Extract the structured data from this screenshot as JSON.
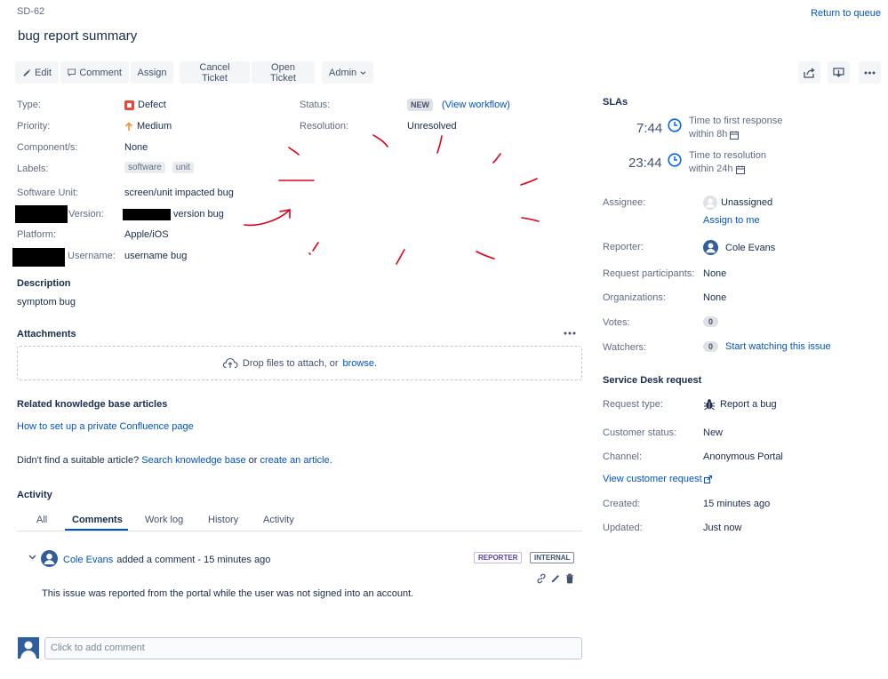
{
  "issue": {
    "key": "SD-62",
    "title": "bug report summary",
    "return_link": "Return to queue"
  },
  "toolbar": {
    "edit": "Edit",
    "comment": "Comment",
    "assign": "Assign",
    "cancel_ticket": "Cancel Ticket",
    "open_ticket": "Open Ticket",
    "admin": "Admin"
  },
  "details": {
    "type_label": "Type:",
    "type_value": "Defect",
    "priority_label": "Priority:",
    "priority_value": "Medium",
    "components_label": "Component/s:",
    "components_value": "None",
    "labels_label": "Labels:",
    "labels": [
      "software",
      "unit"
    ],
    "software_unit_label": "Software Unit:",
    "software_unit_value": "screen/unit impacted bug",
    "version_label": "Version:",
    "version_value": "version bug",
    "platform_label": "Platform:",
    "platform_value": "Apple/iOS",
    "username_label": "Username:",
    "username_value": "username bug",
    "status_label": "Status:",
    "status_value": "NEW",
    "view_workflow": "(View workflow)",
    "resolution_label": "Resolution:",
    "resolution_value": "Unresolved"
  },
  "description": {
    "title": "Description",
    "text": "symptom bug"
  },
  "attachments": {
    "title": "Attachments",
    "drop_text": "Drop files to attach, or",
    "browse": "browse."
  },
  "kb": {
    "title": "Related knowledge base articles",
    "article": "How to set up a private Confluence page",
    "prompt": "Didn't find a suitable article?",
    "search_link": "Search knowledge base",
    "or": "or",
    "create_link": "create an article."
  },
  "activity": {
    "title": "Activity",
    "tabs": [
      "All",
      "Comments",
      "Work log",
      "History",
      "Activity"
    ],
    "active_tab": "Comments",
    "comment": {
      "author": "Cole Evans",
      "meta": "added a comment - 15 minutes ago",
      "badge_reporter": "REPORTER",
      "badge_internal": "INTERNAL",
      "body": "This issue was reported from the portal while the user was not signed into an account."
    },
    "add_comment_placeholder": "Click to add comment"
  },
  "slas": {
    "title": "SLAs",
    "items": [
      {
        "time": "7:44",
        "name": "Time to first response",
        "target": "within 8h"
      },
      {
        "time": "23:44",
        "name": "Time to resolution",
        "target": "within 24h"
      }
    ]
  },
  "people": {
    "assignee_label": "Assignee:",
    "assignee_value": "Unassigned",
    "assign_to_me": "Assign to me",
    "reporter_label": "Reporter:",
    "reporter_value": "Cole Evans",
    "participants_label": "Request participants:",
    "participants_value": "None",
    "organizations_label": "Organizations:",
    "organizations_value": "None",
    "votes_label": "Votes:",
    "votes_value": "0",
    "watchers_label": "Watchers:",
    "watchers_value": "0",
    "start_watching": "Start watching this issue"
  },
  "service_desk": {
    "title": "Service Desk request",
    "request_type_label": "Request type:",
    "request_type_value": "Report a bug",
    "customer_status_label": "Customer status:",
    "customer_status_value": "New",
    "channel_label": "Channel:",
    "channel_value": "Anonymous Portal",
    "view_customer_request": "View customer request",
    "created_label": "Created:",
    "created_value": "15 minutes ago",
    "updated_label": "Updated:",
    "updated_value": "Just now"
  },
  "colors": {
    "link": "#0052cc",
    "annotation_red": "#e0001b",
    "defect_red": "#e5493a",
    "priority_orange": "#f79232",
    "sla_blue": "#0065ff"
  }
}
